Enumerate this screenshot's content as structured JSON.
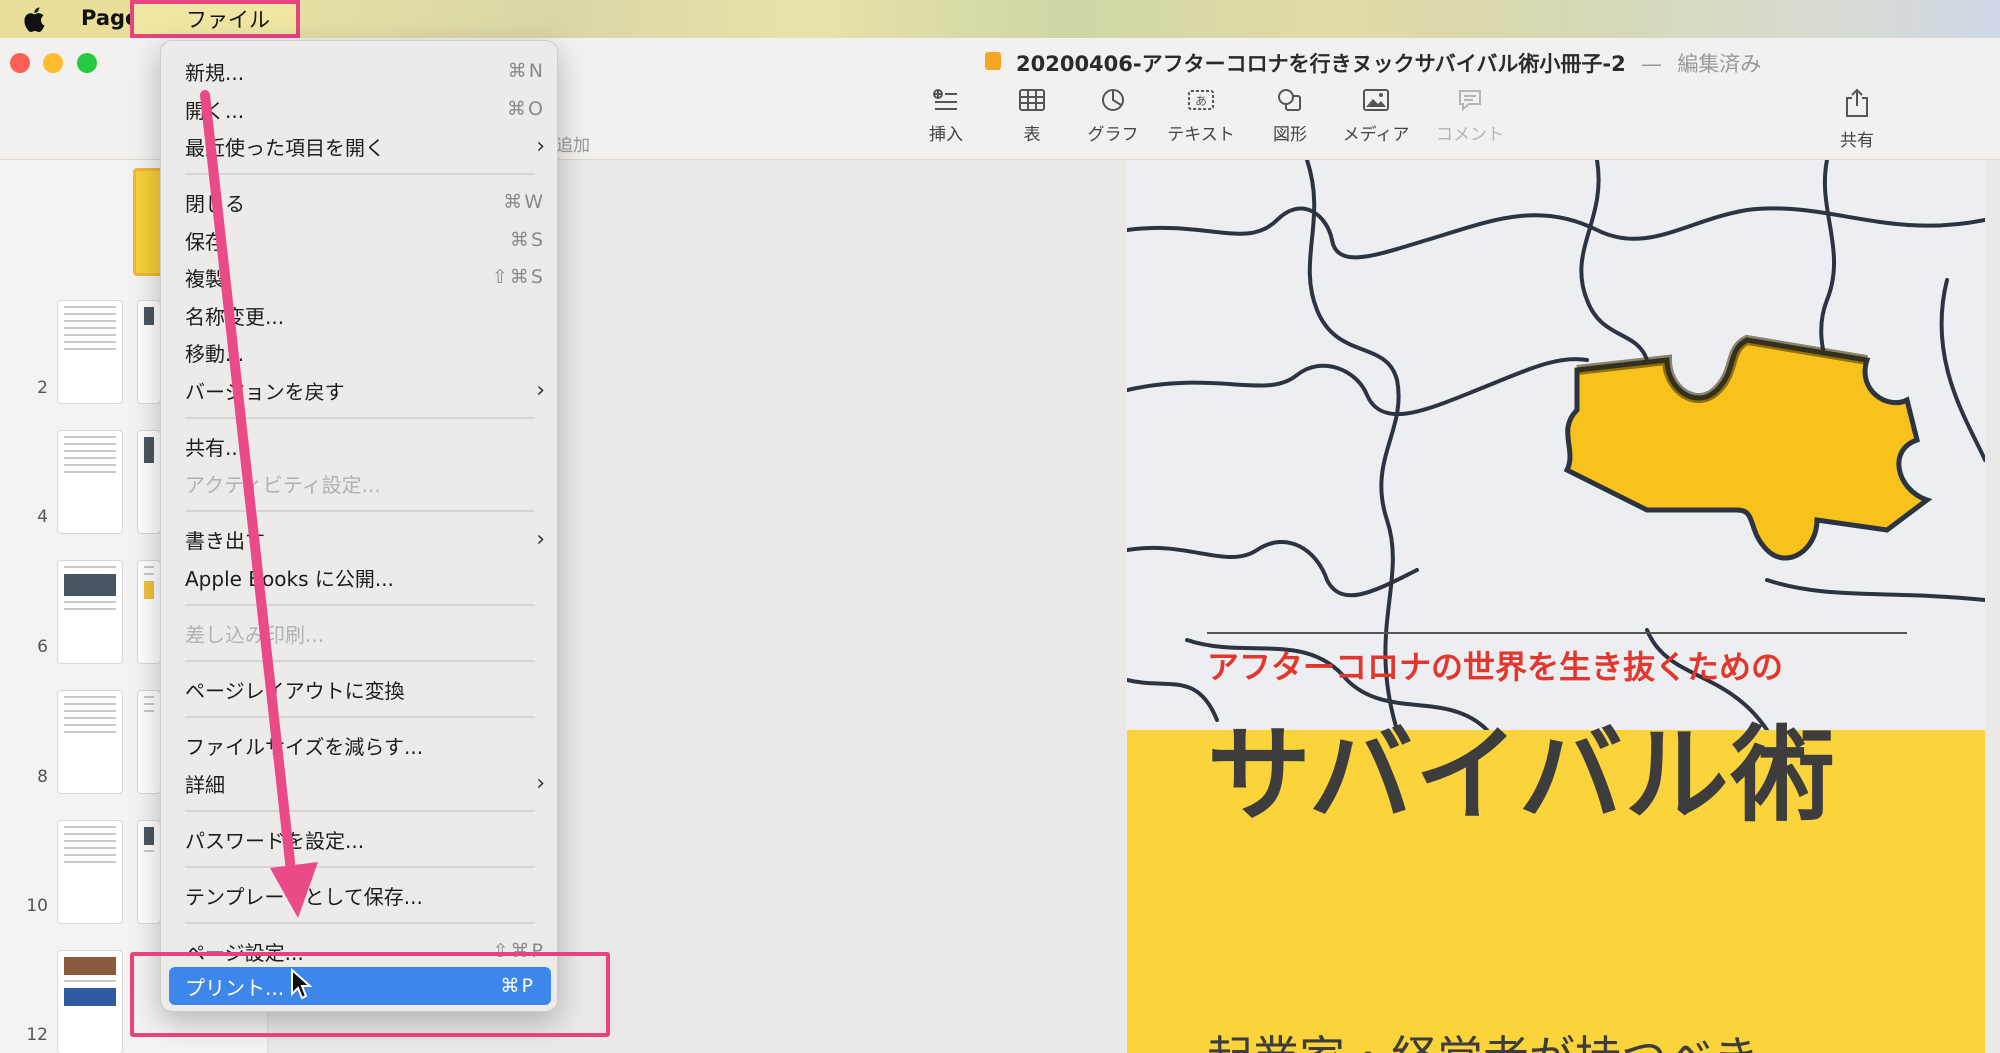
{
  "menubar": {
    "app_name": "Pages",
    "file_menu": "ファイル"
  },
  "window": {
    "document_title": "20200406-アフターコロナを行きヌックサバイバル術小冊子-2",
    "separator": "—",
    "status": "編集済み",
    "add_page": "追加"
  },
  "toolbar": {
    "insert": "挿入",
    "table": "表",
    "chart": "グラフ",
    "text": "テキスト",
    "shape": "図形",
    "media": "メディア",
    "comment": "コメント",
    "share": "共有"
  },
  "sidebar": {
    "page_numbers": [
      "2",
      "4",
      "6",
      "8",
      "10",
      "12"
    ]
  },
  "file_menu": {
    "items": [
      {
        "label": "新規...",
        "shortcut": "⌘N"
      },
      {
        "label": "開く...",
        "shortcut": "⌘O"
      },
      {
        "label": "最近使った項目を開く"
      },
      {
        "label": "閉じる",
        "shortcut": "⌘W"
      },
      {
        "label": "保存",
        "shortcut": "⌘S"
      },
      {
        "label": "複製",
        "shortcut": "⇧⌘S"
      },
      {
        "label": "名称変更..."
      },
      {
        "label": "移動..."
      },
      {
        "label": "バージョンを戻す"
      },
      {
        "label": "共有..."
      },
      {
        "label": "アクティビティ設定..."
      },
      {
        "label": "書き出す"
      },
      {
        "label": "Apple Books に公開..."
      },
      {
        "label": "差し込み印刷..."
      },
      {
        "label": "ページレイアウトに変換"
      },
      {
        "label": "ファイルサイズを減らす..."
      },
      {
        "label": "詳細"
      },
      {
        "label": "パスワードを設定..."
      },
      {
        "label": "テンプレートとして保存..."
      },
      {
        "label": "ページ設定...",
        "shortcut": "⇧⌘P"
      },
      {
        "label": "プリント...",
        "shortcut": "⌘P"
      }
    ]
  },
  "document": {
    "cover_subtitle": "アフターコロナの世界を生き抜くための",
    "cover_title": "サバイバル術",
    "cover_tail": "起業家・経営者が持つべき"
  },
  "colors": {
    "highlight": "#e7437f",
    "menu_selected": "#3d87ea",
    "cover_yellow": "#fbd33b",
    "cover_subtitle": "#e2372c"
  }
}
